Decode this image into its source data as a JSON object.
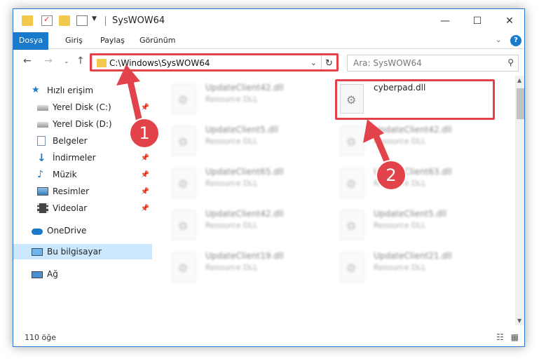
{
  "window": {
    "title": "SysWOW64",
    "controls": {
      "minimize": "—",
      "maximize": "☐",
      "close": "✕"
    }
  },
  "ribbon": {
    "tabs": [
      "Dosya",
      "Giriş",
      "Paylaş",
      "Görünüm"
    ],
    "expand_icon": "chevron-down-icon",
    "help_icon": "help-icon"
  },
  "navigation": {
    "address": "C:\\Windows\\SysWOW64",
    "search_placeholder": "Ara: SysWOW64"
  },
  "sidebar": {
    "items": [
      {
        "label": "Hızlı erişim",
        "icon": "star-icon",
        "pinned": false
      },
      {
        "label": "Yerel Disk (C:)",
        "icon": "drive-icon",
        "pinned": true
      },
      {
        "label": "Yerel Disk (D:)",
        "icon": "drive-icon",
        "pinned": false
      },
      {
        "label": "Belgeler",
        "icon": "document-icon",
        "pinned": false
      },
      {
        "label": "İndirmeler",
        "icon": "download-icon",
        "pinned": true
      },
      {
        "label": "Müzik",
        "icon": "music-icon",
        "pinned": true
      },
      {
        "label": "Resimler",
        "icon": "picture-icon",
        "pinned": true
      },
      {
        "label": "Videolar",
        "icon": "video-icon",
        "pinned": true
      },
      {
        "label": "OneDrive",
        "icon": "cloud-icon",
        "pinned": false
      },
      {
        "label": "Bu bilgisayar",
        "icon": "computer-icon",
        "pinned": false,
        "selected": true
      },
      {
        "label": "Ağ",
        "icon": "network-icon",
        "pinned": false
      }
    ]
  },
  "files": [
    {
      "name": "UpdateClient42.dll",
      "type": "Resource DLL",
      "blurred": true
    },
    {
      "name": "cyberpad.dll",
      "type": "",
      "blurred": false
    },
    {
      "name": "UpdateClient5.dll",
      "type": "Resource DLL",
      "blurred": true
    },
    {
      "name": "UpdateClient42.dll",
      "type": "Resource DLL",
      "blurred": true
    },
    {
      "name": "UpdateClient65.dll",
      "type": "Resource DLL",
      "blurred": true
    },
    {
      "name": "UpdateClient63.dll",
      "type": "Resource DLL",
      "blurred": true
    },
    {
      "name": "UpdateClient42.dll",
      "type": "Resource DLL",
      "blurred": true
    },
    {
      "name": "UpdateClient5.dll",
      "type": "Resource DLL",
      "blurred": true
    },
    {
      "name": "UpdateClient19.dll",
      "type": "Resource DLL",
      "blurred": true
    },
    {
      "name": "UpdateClient21.dll",
      "type": "Resource DLL",
      "blurred": true
    }
  ],
  "status": {
    "item_count": "110 öğe"
  },
  "annotations": {
    "step1": "1",
    "step2": "2",
    "color": "#e2434b"
  }
}
